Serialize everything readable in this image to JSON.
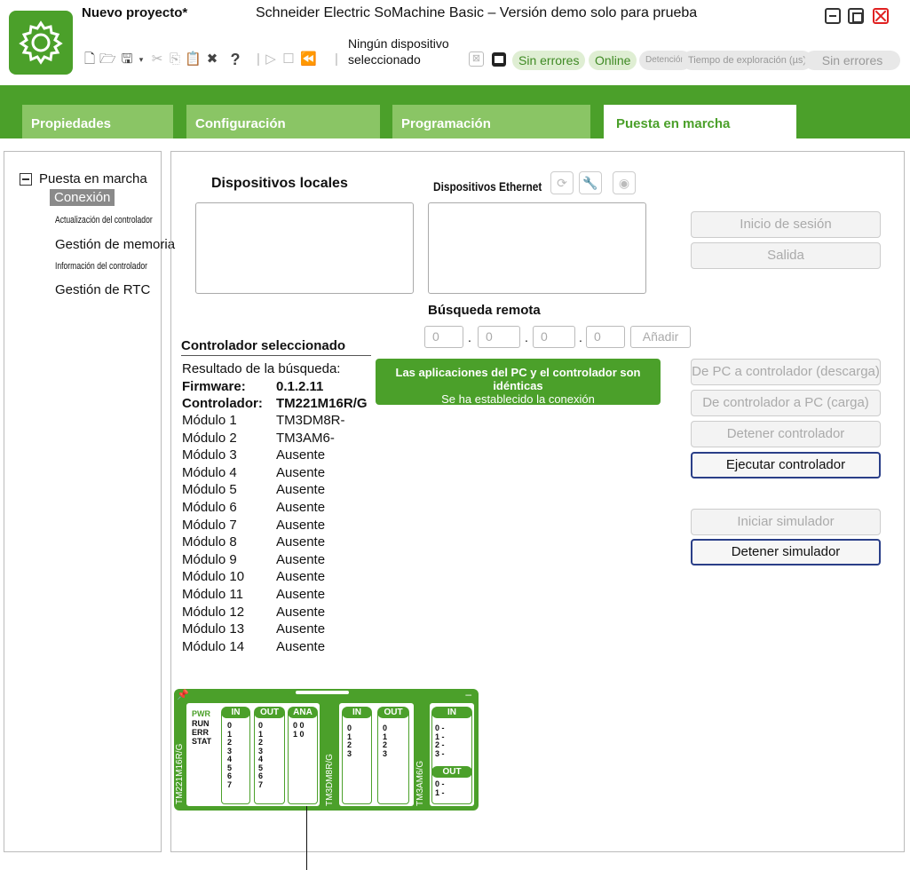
{
  "titlebar": {
    "project_title": "Nuevo proyecto*",
    "app_title": "Schneider Electric SoMachine Basic – Versión demo solo para prueba"
  },
  "toolbar": {
    "no_device_line1": "Ningún dispositivo",
    "no_device_line2": "seleccionado",
    "status_errors": "Sin errores",
    "status_online": "Online",
    "status_stop": "Detención",
    "status_scan_time": "Tiempo de exploración (µs)",
    "status_errors2": "Sin errores",
    "icons": [
      "new-file-icon",
      "open-folder-icon",
      "save-icon",
      "cut-icon",
      "copy-icon",
      "paste-icon",
      "build-icon",
      "help-icon",
      "run-icon",
      "stop-icon",
      "rewind-icon",
      "device-icon",
      "controller-icon"
    ]
  },
  "tabs": [
    {
      "label": "Propiedades"
    },
    {
      "label": "Configuración"
    },
    {
      "label": "Programación"
    },
    {
      "label": "Puesta en marcha",
      "active": true
    }
  ],
  "tree": {
    "root": "Puesta en marcha",
    "items": [
      {
        "label": "Conexión",
        "selected": true
      },
      {
        "label": "Actualización del controlador"
      },
      {
        "label": "Gestión de memoria"
      },
      {
        "label": "Información del controlador"
      },
      {
        "label": "Gestión de RTC"
      }
    ]
  },
  "main": {
    "local_devices_title": "Dispositivos locales",
    "ethernet_devices_title": "Dispositivos Ethernet",
    "remote_search_title": "Búsqueda remota",
    "ip_fields": [
      "0",
      "0",
      "0",
      "0"
    ],
    "add_label": "Añadir",
    "selected_controller_title": "Controlador seleccionado",
    "search_result_label": "Resultado de la búsqueda:",
    "firmware_label": "Firmware:",
    "firmware_value": "0.1.2.11",
    "controller_label": "Controlador:",
    "controller_value": "TM221M16R/G",
    "modules": [
      {
        "label": "Módulo 1",
        "value": "TM3DM8R-"
      },
      {
        "label": "Módulo 2",
        "value": "TM3AM6-"
      },
      {
        "label": "Módulo 3",
        "value": "Ausente"
      },
      {
        "label": "Módulo 4",
        "value": "Ausente"
      },
      {
        "label": "Módulo 5",
        "value": "Ausente"
      },
      {
        "label": "Módulo 6",
        "value": "Ausente"
      },
      {
        "label": "Módulo 7",
        "value": "Ausente"
      },
      {
        "label": "Módulo 8",
        "value": "Ausente"
      },
      {
        "label": "Módulo 9",
        "value": "Ausente"
      },
      {
        "label": "Módulo 10",
        "value": "Ausente"
      },
      {
        "label": "Módulo 11",
        "value": "Ausente"
      },
      {
        "label": "Módulo 12",
        "value": "Ausente"
      },
      {
        "label": "Módulo 13",
        "value": "Ausente"
      },
      {
        "label": "Módulo 14",
        "value": "Ausente"
      }
    ],
    "banner_line1": "Las aplicaciones del PC y el controlador son idénticas",
    "banner_line2": "Se ha establecido la conexión",
    "buttons": {
      "login": "Inicio de sesión",
      "logout": "Salida",
      "download": "De PC a controlador (descarga)",
      "upload": "De controlador a PC (carga)",
      "stop_controller": "Detener controlador",
      "run_controller": "Ejecutar controlador",
      "start_simulator": "Iniciar simulador",
      "stop_simulator": "Detener simulador"
    }
  },
  "diagram": {
    "controller_label": "TM221M16R/G",
    "module1_label": "TM3DM8R/G",
    "module2_label": "TM3AM6/G",
    "status_leds": "PWR\nRUN\nERR\nSTAT",
    "hdr_in": "IN",
    "hdr_out": "OUT",
    "hdr_ana": "ANA",
    "ctrl_in": "0\n1\n2\n3\n4\n5\n6\n7",
    "ctrl_out": "0\n1\n2\n3\n4\n5\n6\n7",
    "ctrl_ana": "0 0\n1 0",
    "m1_in": "0\n1\n2\n3",
    "m1_out": "0\n1\n2\n3",
    "m2_in": "0 -\n1 -\n2 -\n3 -",
    "m2_out": "0 -\n1 -"
  },
  "colors": {
    "brand_green": "#4ba02a",
    "tab_inactive": "#8ac565",
    "button_border_active": "#2a3f88"
  }
}
